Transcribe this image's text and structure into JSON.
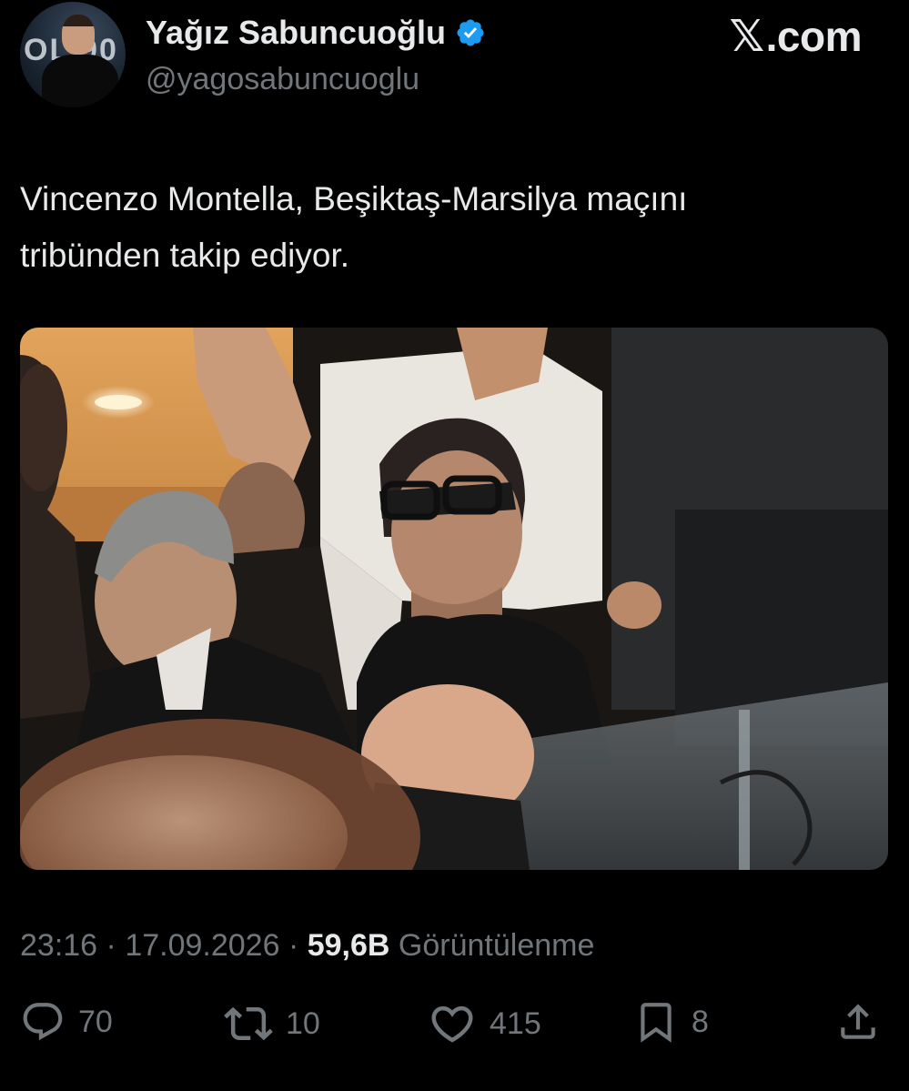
{
  "author": {
    "display_name": "Yağız Sabuncuoğlu",
    "handle": "@yagosabuncuoglu",
    "verified": true,
    "avatar_text": "OL 90"
  },
  "brand": {
    "label": ".com",
    "icon": "x-logo-icon"
  },
  "tweet": {
    "text_line1": "Vincenzo Montella, Beşiktaş-Marsilya maçını",
    "text_line2": "tribünden takip ediyor."
  },
  "media": {
    "type": "photo"
  },
  "meta": {
    "time": "23:16",
    "separator": "·",
    "date": "17.09.2026",
    "views_count": "59,6B",
    "views_label": "Görüntülenme"
  },
  "actions": {
    "reply_count": "70",
    "retweet_count": "10",
    "like_count": "415",
    "bookmark_count": "8"
  },
  "colors": {
    "background": "#000000",
    "primary_text": "#e7e9ea",
    "secondary_text": "#71767b",
    "verified_blue": "#1d9bf0"
  }
}
